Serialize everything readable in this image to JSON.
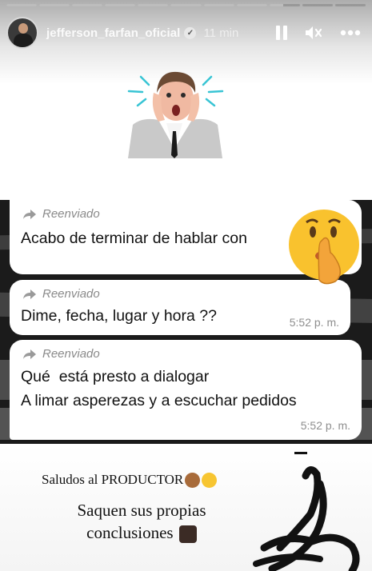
{
  "story": {
    "progress_segments": [
      1,
      1,
      1,
      1,
      1,
      1,
      1,
      1,
      0.45,
      0,
      0
    ],
    "username": "jefferson_farfan_oficial",
    "posted_time": "11 min",
    "icons": {
      "verified": "verified-badge-icon",
      "pause": "pause-icon",
      "mute": "speaker-muted-icon",
      "more": "more-options-icon"
    }
  },
  "chat": {
    "messages": [
      {
        "forward_label": "Reenviado",
        "text": "Acabo de terminar de hablar con",
        "time": ""
      },
      {
        "forward_label": "Reenviado",
        "text": "Dime, fecha, lugar y hora ??",
        "time": "5:52 p. m."
      },
      {
        "forward_label": "Reenviado",
        "text": "Qué  está presto a dialogar\nA limar asperezas y a escuchar pedidos",
        "time": "5:52 p. m."
      }
    ]
  },
  "captions": {
    "line1": "Saludos al PRODUCTOR",
    "line2": "Saquen sus propias conclusiones"
  },
  "colors": {
    "bubble": "#ffffff",
    "chat_bg": "#1b1b1b",
    "forward_text": "#8a8a8a"
  }
}
